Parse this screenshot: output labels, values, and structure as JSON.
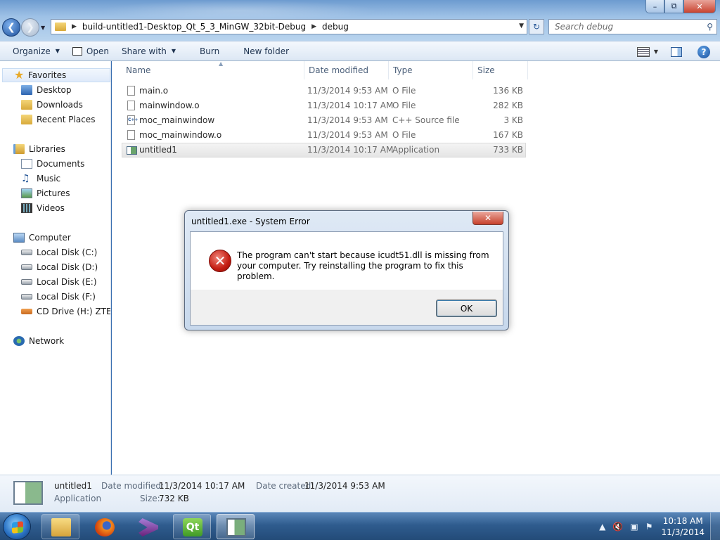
{
  "window": {
    "minimize": "–",
    "maximize": "⧉",
    "close": "✕"
  },
  "address": {
    "segment1": "build-untitled1-Desktop_Qt_5_3_MinGW_32bit-Debug",
    "segment2": "debug"
  },
  "search": {
    "placeholder": "Search debug"
  },
  "toolbar": {
    "organize": "Organize",
    "open": "Open",
    "share_with": "Share with",
    "burn": "Burn",
    "new_folder": "New folder"
  },
  "nav": {
    "favorites": "Favorites",
    "desktop": "Desktop",
    "downloads": "Downloads",
    "recent_places": "Recent Places",
    "libraries": "Libraries",
    "documents": "Documents",
    "music": "Music",
    "pictures": "Pictures",
    "videos": "Videos",
    "computer": "Computer",
    "disk_c": "Local Disk (C:)",
    "disk_d": "Local Disk (D:)",
    "disk_e": "Local Disk (E:)",
    "disk_f": "Local Disk (F:)",
    "cd_drive": "CD Drive (H:) ZTEMO",
    "network": "Network"
  },
  "columns": {
    "name": "Name",
    "date_modified": "Date modified",
    "type": "Type",
    "size": "Size"
  },
  "files": [
    {
      "name": "main.o",
      "date": "11/3/2014 9:53 AM",
      "type": "O File",
      "size": "136 KB"
    },
    {
      "name": "mainwindow.o",
      "date": "11/3/2014 10:17 AM",
      "type": "O File",
      "size": "282 KB"
    },
    {
      "name": "moc_mainwindow",
      "date": "11/3/2014 9:53 AM",
      "type": "C++ Source file",
      "size": "3 KB"
    },
    {
      "name": "moc_mainwindow.o",
      "date": "11/3/2014 9:53 AM",
      "type": "O File",
      "size": "167 KB"
    },
    {
      "name": "untitled1",
      "date": "11/3/2014 10:17 AM",
      "type": "Application",
      "size": "733 KB"
    }
  ],
  "details": {
    "name": "untitled1",
    "kind": "Application",
    "date_modified_label": "Date modified:",
    "date_modified": "11/3/2014 10:17 AM",
    "date_created_label": "Date created:",
    "date_created": "11/3/2014 9:53 AM",
    "size_label": "Size:",
    "size": "732 KB"
  },
  "dialog": {
    "title": "untitled1.exe - System Error",
    "message": "The program can't start because icudt51.dll is missing from your computer. Try reinstalling the program to fix this problem.",
    "ok": "OK",
    "close": "✕"
  },
  "taskbar": {
    "qt_label": "Qt",
    "time": "10:18 AM",
    "date": "11/3/2014"
  }
}
